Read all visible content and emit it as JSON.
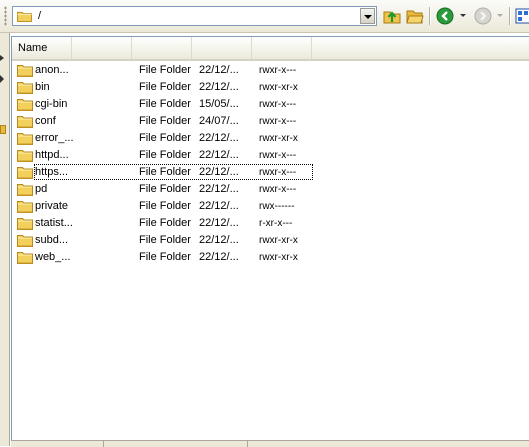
{
  "address_bar": {
    "path": "/"
  },
  "toolbar": {
    "icons": [
      "folder-up-icon",
      "open-folder-icon",
      "back-icon",
      "forward-icon",
      "view-icon"
    ]
  },
  "columns": {
    "name": "Name"
  },
  "files": [
    {
      "name": "anon...",
      "type": "File Folder",
      "date": "22/12/...",
      "perms": "rwxr-x---"
    },
    {
      "name": "bin",
      "type": "File Folder",
      "date": "22/12/...",
      "perms": "rwxr-xr-x"
    },
    {
      "name": "cgi-bin",
      "type": "File Folder",
      "date": "15/05/...",
      "perms": "rwxr-x---"
    },
    {
      "name": "conf",
      "type": "File Folder",
      "date": "24/07/...",
      "perms": "rwxr-x---"
    },
    {
      "name": "error_...",
      "type": "File Folder",
      "date": "22/12/...",
      "perms": "rwxr-xr-x"
    },
    {
      "name": "httpd...",
      "type": "File Folder",
      "date": "22/12/...",
      "perms": "rwxr-x---"
    },
    {
      "name": "https...",
      "type": "File Folder",
      "date": "22/12/...",
      "perms": "rwxr-x---"
    },
    {
      "name": "pd",
      "type": "File Folder",
      "date": "22/12/...",
      "perms": "rwxr-x---"
    },
    {
      "name": "private",
      "type": "File Folder",
      "date": "22/12/...",
      "perms": "rwx------"
    },
    {
      "name": "statist...",
      "type": "File Folder",
      "date": "22/12/...",
      "perms": "r-xr-x---"
    },
    {
      "name": "subd...",
      "type": "File Folder",
      "date": "22/12/...",
      "perms": "rwxr-xr-x"
    },
    {
      "name": "web_...",
      "type": "File Folder",
      "date": "22/12/...",
      "perms": "rwxr-xr-x"
    }
  ],
  "focused_row": 6
}
